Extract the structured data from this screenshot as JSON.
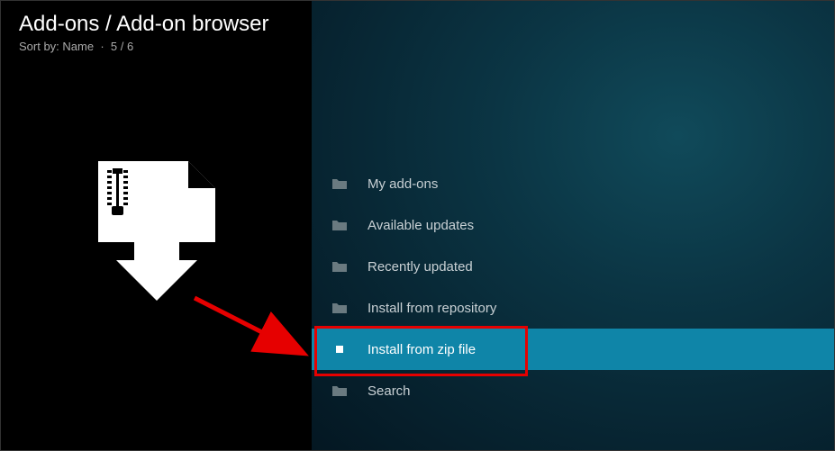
{
  "header": {
    "breadcrumb": "Add-ons / Add-on browser",
    "sort_label": "Sort by: Name",
    "position": "5 / 6"
  },
  "menu": {
    "items": [
      {
        "label": "My add-ons",
        "selected": false
      },
      {
        "label": "Available updates",
        "selected": false
      },
      {
        "label": "Recently updated",
        "selected": false
      },
      {
        "label": "Install from repository",
        "selected": false
      },
      {
        "label": "Install from zip file",
        "selected": true
      },
      {
        "label": "Search",
        "selected": false
      }
    ]
  },
  "annotation": {
    "highlight_index": 4,
    "arrow_color": "#e60000"
  }
}
